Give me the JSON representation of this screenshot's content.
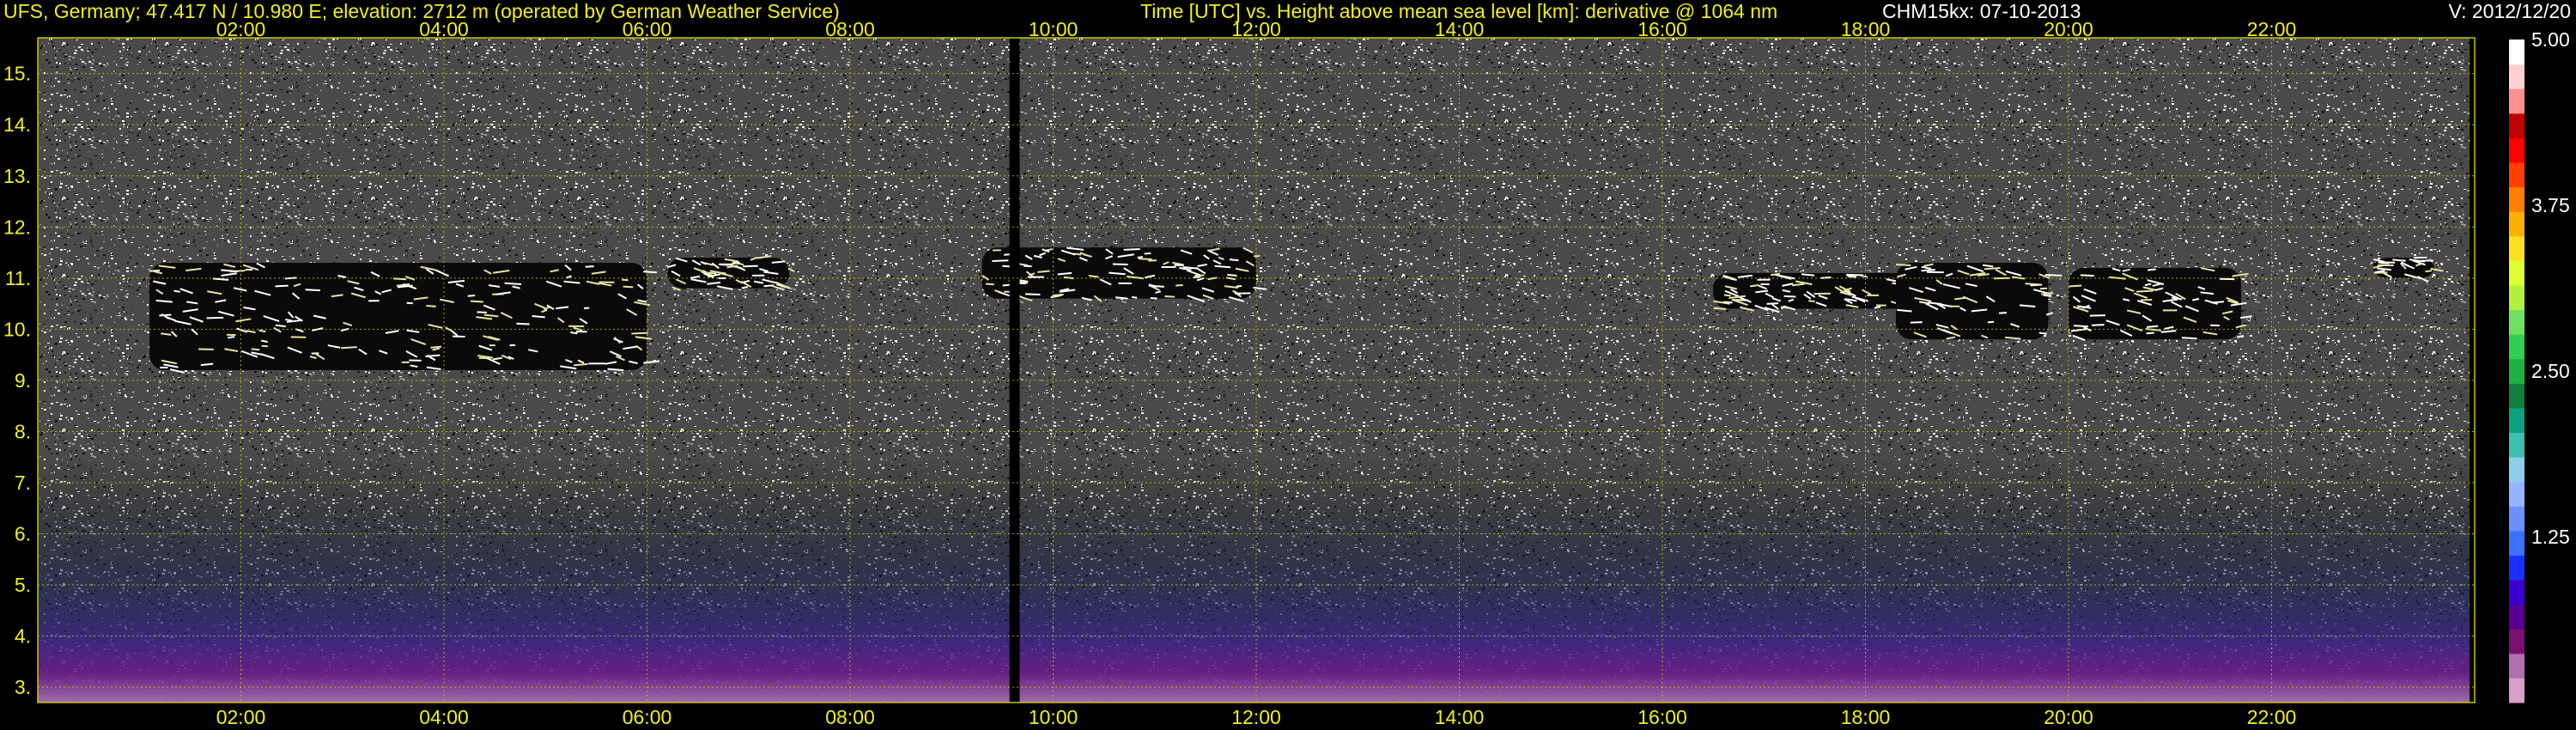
{
  "header": {
    "site_info": "UFS, Germany; 47.417 N / 10.980 E; elevation: 2712 m  (operated by German Weather Service)",
    "title": "Time [UTC] vs. Height above mean sea level [km]: derivative @ 1064 nm",
    "instrument_date": "CHM15kx: 07-10-2013",
    "version": "V: 2012/12/20"
  },
  "colors": {
    "axis_text": "#f2ee1c",
    "header_text": "#f2ee1c",
    "version_text": "#ffffff",
    "grid": "#c8c400",
    "background": "#000000"
  },
  "chart_data": {
    "type": "heatmap",
    "title": "Time [UTC] vs. Height above mean sea level [km]: derivative @ 1064 nm",
    "xlabel": "Time [UTC]",
    "ylabel": "Height above mean sea level [km]",
    "x_ticks": [
      "02:00",
      "04:00",
      "06:00",
      "08:00",
      "10:00",
      "12:00",
      "14:00",
      "16:00",
      "18:00",
      "20:00",
      "22:00"
    ],
    "x_tick_hours": [
      2,
      4,
      6,
      8,
      10,
      12,
      14,
      16,
      18,
      20,
      22
    ],
    "xlim_hours": [
      0,
      24
    ],
    "y_ticks": [
      "3.",
      "4.",
      "5.",
      "6.",
      "7.",
      "8.",
      "9.",
      "10.",
      "11.",
      "12.",
      "13.",
      "14.",
      "15."
    ],
    "y_tick_values": [
      3,
      4,
      5,
      6,
      7,
      8,
      9,
      10,
      11,
      12,
      13,
      14,
      15
    ],
    "ylim_km": [
      2.7,
      15.7
    ],
    "grid": true,
    "colorbar": {
      "ticks": [
        "5.00",
        "3.75",
        "2.50",
        "1.25"
      ],
      "tick_values": [
        5.0,
        3.75,
        2.5,
        1.25
      ],
      "range": [
        0,
        5.0
      ],
      "colors": [
        "#d6a0c8",
        "#b070b0",
        "#7a1070",
        "#5a0090",
        "#3a00d0",
        "#1a30ff",
        "#3c70ff",
        "#6e90ff",
        "#96b4ff",
        "#8ad0e8",
        "#40c0b0",
        "#10a080",
        "#108040",
        "#20b040",
        "#30d050",
        "#70e060",
        "#b0f040",
        "#e0ff30",
        "#ffe020",
        "#ffb000",
        "#ff8000",
        "#ff4000",
        "#ff0000",
        "#c00000",
        "#ff9090",
        "#ffd0d0",
        "#ffffff"
      ]
    },
    "cloud_layers": [
      {
        "start_hour": 1.1,
        "end_hour": 6.0,
        "base_km": 9.2,
        "top_km": 11.3
      },
      {
        "start_hour": 6.2,
        "end_hour": 7.4,
        "base_km": 10.8,
        "top_km": 11.4
      },
      {
        "start_hour": 9.3,
        "end_hour": 12.0,
        "base_km": 10.6,
        "top_km": 11.6
      },
      {
        "start_hour": 16.5,
        "end_hour": 18.5,
        "base_km": 10.4,
        "top_km": 11.1
      },
      {
        "start_hour": 18.3,
        "end_hour": 19.8,
        "base_km": 9.8,
        "top_km": 11.3
      },
      {
        "start_hour": 20.0,
        "end_hour": 21.7,
        "base_km": 9.8,
        "top_km": 11.2
      },
      {
        "start_hour": 23.0,
        "end_hour": 23.6,
        "base_km": 11.0,
        "top_km": 11.4
      }
    ],
    "data_gaps": [
      {
        "start_hour": 9.57,
        "end_hour": 9.67
      },
      {
        "start_hour": 23.95,
        "end_hour": 24.0
      }
    ]
  }
}
